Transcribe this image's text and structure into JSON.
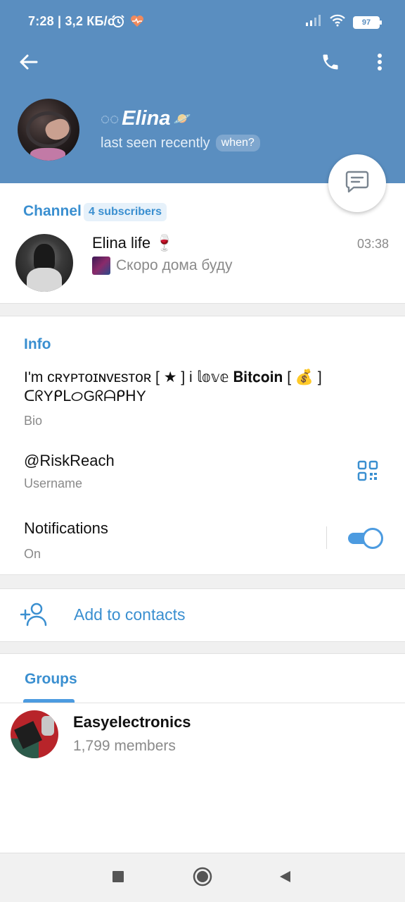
{
  "status_bar": {
    "time": "7:28 | 3,2 КБ/с",
    "battery": "97"
  },
  "profile": {
    "name": "Elina",
    "status": "last seen recently",
    "when_label": "when?"
  },
  "channel": {
    "section_label": "Channel",
    "subscribers_badge": "4 subscribers",
    "title": "Elina life",
    "title_emoji": "🍷",
    "time": "03:38",
    "last_message": "Скоро дома буду"
  },
  "info": {
    "section_label": "Info",
    "bio_line1": "I'm ᴄʀʏᴘᴛᴏɪɴᴠᴇsᴛᴏʀ [ ★ ] i 𝕝𝕠𝕧𝕖 𝐁𝐢𝐭𝐜𝐨𝐢𝐧 [ 💰 ]",
    "bio_line2": "ᑕᖇYᑭᒪᝪGᖇᗩᑭᕼY",
    "bio_caption": "Bio",
    "username": "@RiskReach",
    "username_caption": "Username",
    "notifications_label": "Notifications",
    "notifications_state": "On",
    "notifications_enabled": true
  },
  "actions": {
    "add_to_contacts": "Add to contacts"
  },
  "groups": {
    "tab_label": "Groups",
    "items": [
      {
        "name": "Easyelectronics",
        "members": "1,799 members"
      }
    ]
  },
  "colors": {
    "header": "#5a8ec0",
    "accent": "#3a8fd0",
    "toggle": "#4c9be0"
  }
}
